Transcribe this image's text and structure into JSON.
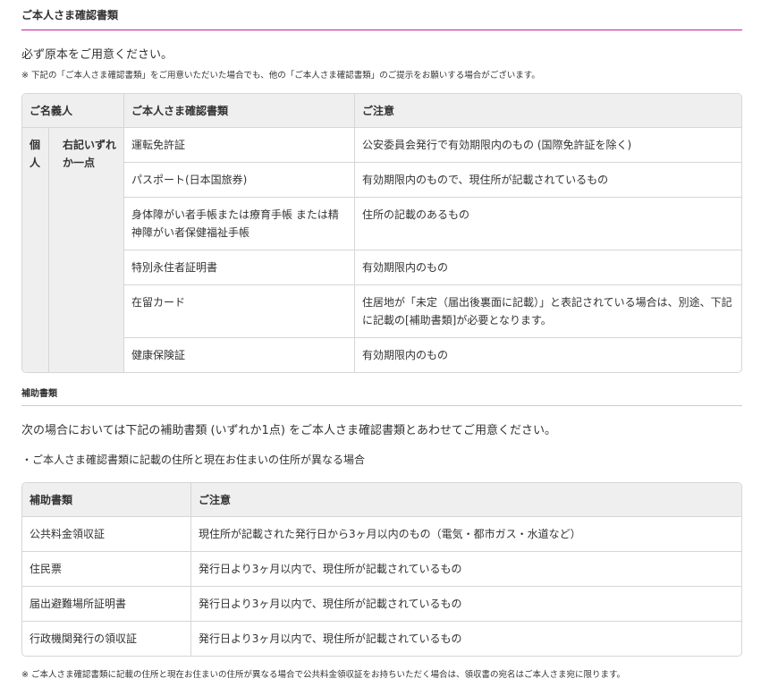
{
  "section_title": "ご本人さま確認書類",
  "lead": "必ず原本をご用意ください。",
  "note": "※ 下記の「ご本人さま確認書類」をご用意いただいた場合でも、他の「ご本人さま確認書類」のご提示をお願いする場合がございます。",
  "id_table": {
    "headers": [
      "ご名義人",
      "ご本人さま確認書類",
      "ご注意"
    ],
    "holder": "個人",
    "condition": "右記いずれか一点",
    "rows": [
      {
        "doc": "運転免許証",
        "note": "公安委員会発行で有効期限内のもの (国際免許証を除く)"
      },
      {
        "doc": "パスポート(日本国旅券)",
        "note": "有効期限内のもので、現住所が記載されているもの"
      },
      {
        "doc": "身体障がい者手帳または療育手帳 または精神障がい者保健福祉手帳",
        "note": "住所の記載のあるもの"
      },
      {
        "doc": "特別永住者証明書",
        "note": "有効期限内のもの"
      },
      {
        "doc": "在留カード",
        "note": "住居地が「未定（届出後裏面に記載）」と表記されている場合は、別途、下記に記載の[補助書類]が必要となります。"
      },
      {
        "doc": "健康保険証",
        "note": "有効期限内のもの"
      }
    ]
  },
  "sub_title": "補助書類",
  "sub_lead": "次の場合においては下記の補助書類 (いずれか1点) をご本人さま確認書類とあわせてご用意ください。",
  "sub_case": "・ご本人さま確認書類に記載の住所と現在お住まいの住所が異なる場合",
  "aux_table": {
    "headers": [
      "補助書類",
      "ご注意"
    ],
    "rows": [
      {
        "doc": "公共料金領収証",
        "note": "現住所が記載された発行日から3ヶ月以内のもの（電気・都市ガス・水道など）"
      },
      {
        "doc": "住民票",
        "note": "発行日より3ヶ月以内で、現住所が記載されているもの"
      },
      {
        "doc": "届出避難場所証明書",
        "note": "発行日より3ヶ月以内で、現住所が記載されているもの"
      },
      {
        "doc": "行政機関発行の領収証",
        "note": "発行日より3ヶ月以内で、現住所が記載されているもの"
      }
    ]
  },
  "footnote": "※ ご本人さま確認書類に記載の住所と現在お住まいの住所が異なる場合で公共料金領収証をお持ちいただく場合は、領収書の宛名はご本人さま宛に限ります。"
}
